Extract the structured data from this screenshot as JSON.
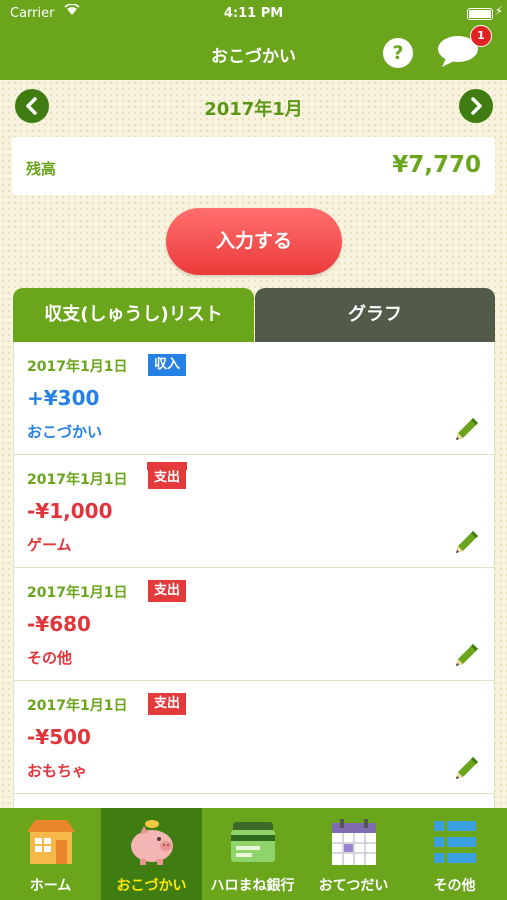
{
  "status_bar": {
    "carrier": "Carrier",
    "time": "4:11 PM"
  },
  "header": {
    "title": "おこづかい",
    "help_label": "?",
    "chat_badge": "1"
  },
  "month": {
    "label": "2017年1月",
    "prev_icon": "chevron-left",
    "next_icon": "chevron-right"
  },
  "balance": {
    "label": "残高",
    "amount": "¥7,770"
  },
  "input_button": {
    "label": "入力する"
  },
  "tabs": [
    {
      "label": "収支(しゅうし)リスト",
      "active": true
    },
    {
      "label": "グラフ",
      "active": false
    }
  ],
  "transactions": [
    {
      "date": "2017年1月1日",
      "type": "収入",
      "amount": "+¥300",
      "category": "おこづかい"
    },
    {
      "date": "2017年1月1日",
      "type": "支出",
      "amount": "-¥1,000",
      "category": "ゲーム"
    },
    {
      "date": "2017年1月1日",
      "type": "支出",
      "amount": "-¥680",
      "category": "その他"
    },
    {
      "date": "2017年1月1日",
      "type": "支出",
      "amount": "-¥500",
      "category": "おもちゃ"
    }
  ],
  "tab_bar": [
    {
      "label": "ホーム",
      "icon": "house-icon",
      "active": false
    },
    {
      "label": "おこづかい",
      "icon": "piggy-bank-icon",
      "active": true
    },
    {
      "label": "ハロまね銀行",
      "icon": "bank-card-icon",
      "active": false
    },
    {
      "label": "おてつだい",
      "icon": "calendar-icon",
      "active": false
    },
    {
      "label": "その他",
      "icon": "list-icon",
      "active": false
    }
  ],
  "colors": {
    "primary_green": "#6aa51c",
    "dark_green": "#3f7d12",
    "income_blue": "#2780e3",
    "expense_red": "#e33b3b"
  }
}
